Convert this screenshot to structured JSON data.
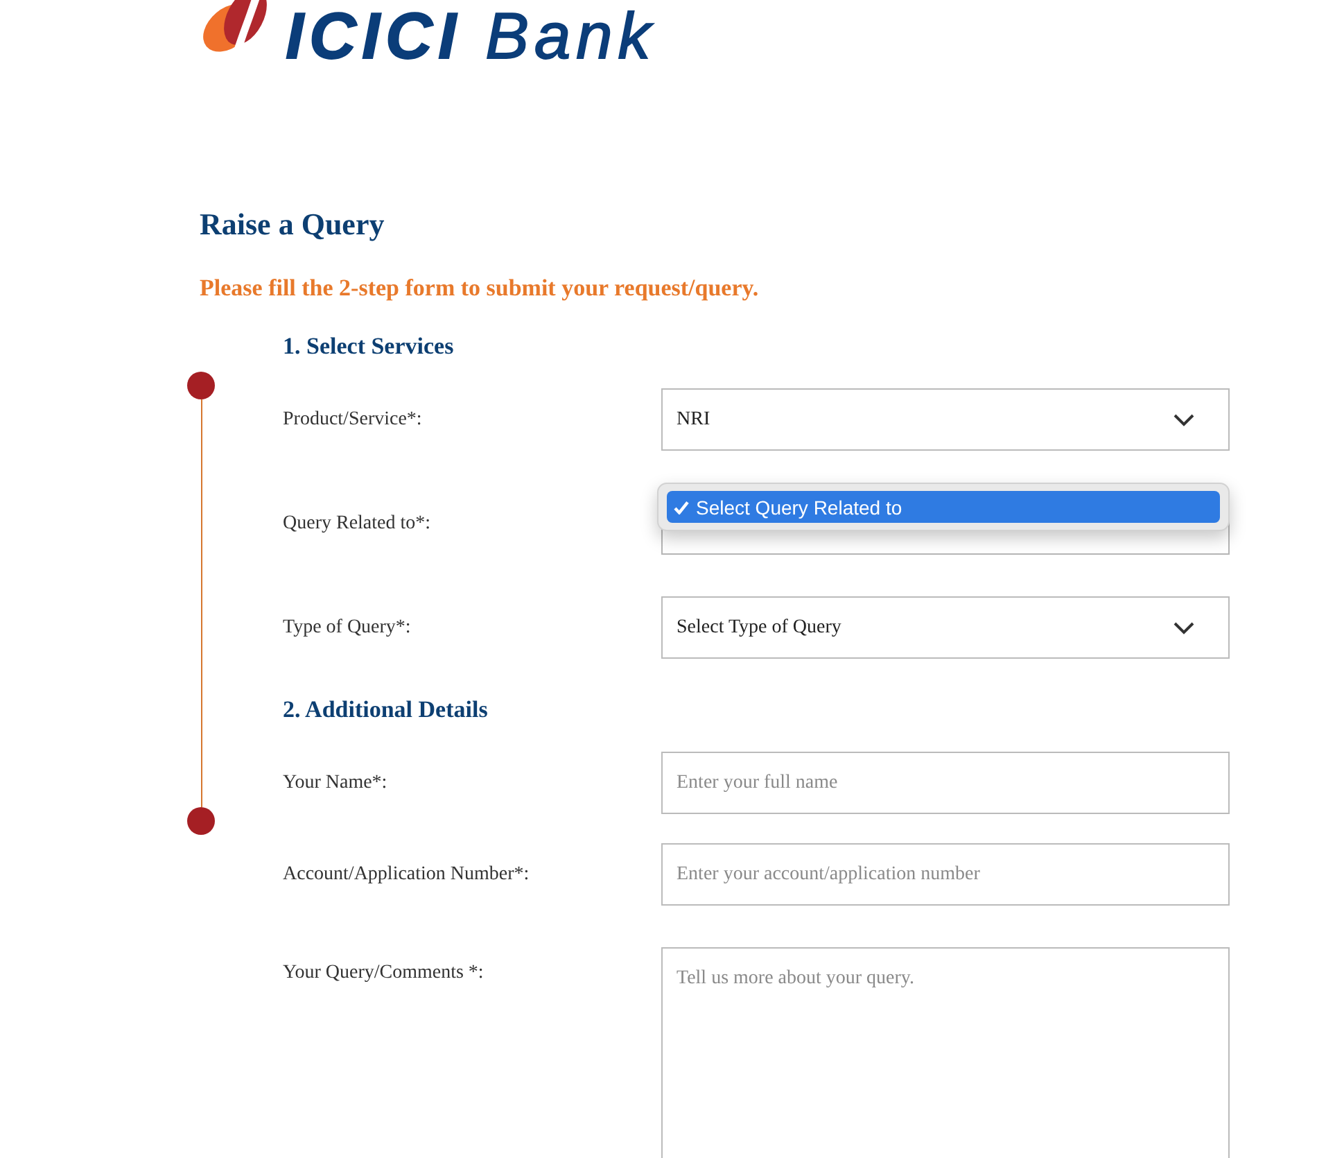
{
  "header": {
    "logo_text": "**ICICI** Bank"
  },
  "page": {
    "title": "Raise a Query",
    "subtitle": "Please fill the 2-step form to submit your request/query."
  },
  "steps": [
    {
      "heading": "1. Select Services",
      "fields": [
        {
          "kind": "select",
          "label": "Product/Service*:",
          "value": "NRI",
          "expanded": false
        },
        {
          "kind": "select",
          "label": "Query Related to*:",
          "expanded": true,
          "options": [
            {
              "label": "Select Query Related to",
              "selected": true
            }
          ]
        },
        {
          "kind": "select",
          "label": "Type of Query*:",
          "value": "Select Type of Query",
          "expanded": false
        }
      ]
    },
    {
      "heading": "2. Additional Details",
      "fields": [
        {
          "kind": "input",
          "label": "Your Name*:",
          "placeholder": "Enter your full name"
        },
        {
          "kind": "input",
          "label": "Account/Application Number*:",
          "placeholder": "Enter your account/application number"
        },
        {
          "kind": "textarea",
          "label": "Your Query/Comments *:",
          "placeholder": "Tell us more about your query."
        }
      ]
    }
  ]
}
